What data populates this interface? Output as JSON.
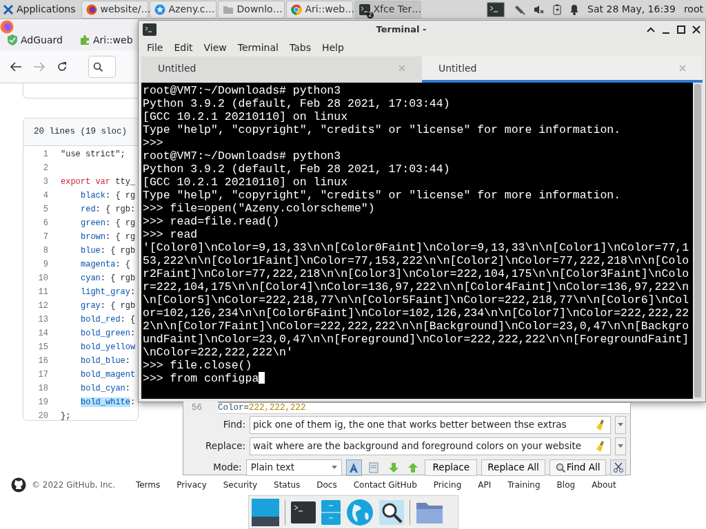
{
  "panel": {
    "menu": "Applications",
    "tasks": [
      {
        "label": "website/…",
        "selected": false
      },
      {
        "label": "Azeny.c…",
        "selected": false
      },
      {
        "label": "Downlo…",
        "selected": false
      },
      {
        "label": "Ari::web…",
        "selected": false
      },
      {
        "label": "Xfce Ter…",
        "badge": "2",
        "selected": true
      }
    ],
    "clock": "Sat 28 May, 16:39",
    "user": "root"
  },
  "browser": {
    "bookmarks": [
      "AdGuard",
      "Ari::web"
    ],
    "file_info": "20 lines (19 sloc)",
    "code_lines": [
      {
        "number": "1",
        "kind": "top",
        "tokens": [
          {
            "kind": "string",
            "text": "\"use strict\";"
          }
        ]
      },
      {
        "number": "2"
      },
      {
        "number": "3",
        "kind": "top",
        "tokens": [
          {
            "kind": "keyword",
            "text": "export"
          },
          {
            "kind": "keyword",
            "text": " var"
          },
          {
            "kind": "plain",
            "text": " tty_"
          }
        ]
      },
      {
        "number": "4",
        "kind": "member",
        "tokens": [
          {
            "kind": "property",
            "text": "black"
          },
          {
            "kind": "plain",
            "text": ": { rg"
          }
        ]
      },
      {
        "number": "5",
        "kind": "member",
        "tokens": [
          {
            "kind": "property",
            "text": "red"
          },
          {
            "kind": "plain",
            "text": ": { rgb:"
          }
        ]
      },
      {
        "number": "6",
        "kind": "member",
        "tokens": [
          {
            "kind": "property",
            "text": "green"
          },
          {
            "kind": "plain",
            "text": ": { rg"
          }
        ]
      },
      {
        "number": "7",
        "kind": "member",
        "tokens": [
          {
            "kind": "property",
            "text": "brown"
          },
          {
            "kind": "plain",
            "text": ": { rg"
          }
        ]
      },
      {
        "number": "8",
        "kind": "member",
        "tokens": [
          {
            "kind": "property",
            "text": "blue"
          },
          {
            "kind": "plain",
            "text": ": { rgb"
          }
        ]
      },
      {
        "number": "9",
        "kind": "member",
        "tokens": [
          {
            "kind": "property",
            "text": "magenta"
          },
          {
            "kind": "plain",
            "text": ": {"
          }
        ]
      },
      {
        "number": "10",
        "kind": "member",
        "tokens": [
          {
            "kind": "property",
            "text": "cyan"
          },
          {
            "kind": "plain",
            "text": ": { rgb"
          }
        ]
      },
      {
        "number": "11",
        "kind": "member",
        "tokens": [
          {
            "kind": "property",
            "text": "light_gray"
          },
          {
            "kind": "plain",
            "text": ":"
          }
        ]
      },
      {
        "number": "12",
        "kind": "member",
        "tokens": [
          {
            "kind": "property",
            "text": "gray"
          },
          {
            "kind": "plain",
            "text": ": { rgb"
          }
        ]
      },
      {
        "number": "13",
        "kind": "member",
        "tokens": [
          {
            "kind": "property",
            "text": "bold_red"
          },
          {
            "kind": "plain",
            "text": ": {"
          }
        ]
      },
      {
        "number": "14",
        "kind": "member",
        "tokens": [
          {
            "kind": "property",
            "text": "bold_green"
          },
          {
            "kind": "plain",
            "text": ":"
          }
        ]
      },
      {
        "number": "15",
        "kind": "member",
        "tokens": [
          {
            "kind": "property",
            "text": "bold_yellow"
          }
        ]
      },
      {
        "number": "16",
        "kind": "member",
        "tokens": [
          {
            "kind": "property",
            "text": "bold_blue"
          },
          {
            "kind": "plain",
            "text": ":"
          }
        ]
      },
      {
        "number": "17",
        "kind": "member",
        "tokens": [
          {
            "kind": "property",
            "text": "bold_magent"
          }
        ]
      },
      {
        "number": "18",
        "kind": "member",
        "tokens": [
          {
            "kind": "property",
            "text": "bold_cyan"
          },
          {
            "kind": "plain",
            "text": ":"
          }
        ]
      },
      {
        "number": "19",
        "kind": "member",
        "tokens": [
          {
            "kind": "property",
            "text": "bold_white",
            "highlighted": true
          },
          {
            "kind": "plain",
            "text": ":"
          }
        ]
      },
      {
        "number": "20",
        "kind": "top",
        "tokens": [
          {
            "kind": "plain",
            "text": "};"
          }
        ]
      }
    ],
    "footer": {
      "copyright": "© 2022 GitHub, Inc.",
      "links": [
        "Terms",
        "Privacy",
        "Security",
        "Status",
        "Docs",
        "Contact GitHub",
        "Pricing",
        "API",
        "Training",
        "Blog",
        "About"
      ]
    }
  },
  "editor": {
    "line_number": "56",
    "line_tokens": [
      {
        "kind": "property",
        "text": "Color"
      },
      {
        "kind": "operator",
        "text": "="
      },
      {
        "kind": "number",
        "text": "222,222,222"
      }
    ],
    "find_label": "Find:",
    "find_value": "pick one of them ig, the one that works better between thse extras",
    "replace_label": "Replace:",
    "replace_value": "wait where are the background and foreground colors on your website",
    "mode_label": "Mode:",
    "mode_value": "Plain text",
    "buttons": [
      "Replace",
      "Replace All",
      "Find All"
    ]
  },
  "terminal": {
    "title": "Terminal -",
    "menu": [
      "File",
      "Edit",
      "View",
      "Terminal",
      "Tabs",
      "Help"
    ],
    "tabs": [
      {
        "label": "Untitled",
        "selected": false
      },
      {
        "label": "Untitled",
        "selected": true
      }
    ],
    "lines": [
      "root@VM7:~/Downloads# python3",
      "Python 3.9.2 (default, Feb 28 2021, 17:03:44)",
      "[GCC 10.2.1 20210110] on linux",
      "Type \"help\", \"copyright\", \"credits\" or \"license\" for more information.",
      ">>>",
      "root@VM7:~/Downloads# python3",
      "Python 3.9.2 (default, Feb 28 2021, 17:03:44)",
      "[GCC 10.2.1 20210110] on linux",
      "Type \"help\", \"copyright\", \"credits\" or \"license\" for more information.",
      ">>> file=open(\"Azeny.colorscheme\")",
      ">>> read=file.read()",
      ">>> read",
      "'[Color0]\\nColor=9,13,33\\n\\n[Color0Faint]\\nColor=9,13,33\\n\\n[Color1]\\nColor=77,1",
      "53,222\\n\\n[Color1Faint]\\nColor=77,153,222\\n\\n[Color2]\\nColor=77,222,218\\n\\n[Colo",
      "r2Faint]\\nColor=77,222,218\\n\\n[Color3]\\nColor=222,104,175\\n\\n[Color3Faint]\\nColo",
      "r=222,104,175\\n\\n[Color4]\\nColor=136,97,222\\n\\n[Color4Faint]\\nColor=136,97,222\\n",
      "\\n[Color5]\\nColor=222,218,77\\n\\n[Color5Faint]\\nColor=222,218,77\\n\\n[Color6]\\nCol",
      "or=102,126,234\\n\\n[Color6Faint]\\nColor=102,126,234\\n\\n[Color7]\\nColor=222,222,22",
      "2\\n\\n[Color7Faint]\\nColor=222,222,222\\n\\n[Background]\\nColor=23,0,47\\n\\n[Backgro",
      "undFaint]\\nColor=23,0,47\\n\\n[Foreground]\\nColor=222,222,222\\n\\n[ForegroundFaint]",
      "\\nColor=222,222,222\\n'",
      ">>> file.close()",
      ">>> from configpa"
    ]
  }
}
